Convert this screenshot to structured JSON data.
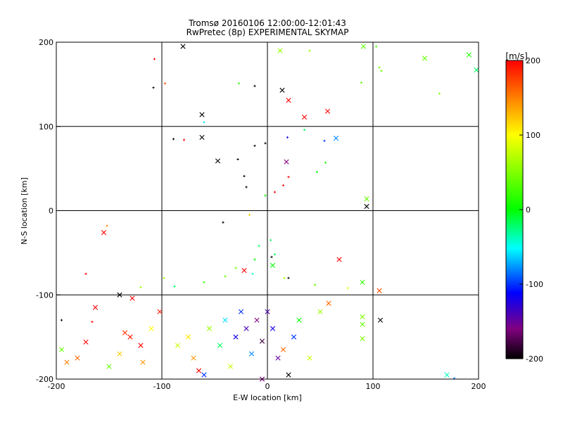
{
  "chart_data": {
    "type": "scatter",
    "title": "Tromsø 20160106 12:00:00-12:01:43",
    "subtitle": "RwPretec (8p) EXPERIMENTAL SKYMAP",
    "xlabel": "E-W location [km]",
    "ylabel": "N-S location [km]",
    "xlim": [
      -200,
      200
    ],
    "ylim": [
      -200,
      200
    ],
    "xticks": [
      "-200",
      "-100",
      "0",
      "100",
      "200"
    ],
    "yticks": [
      "-200",
      "-100",
      "0",
      "100",
      "200"
    ],
    "grid": true,
    "colorbar": {
      "label": "[m/s]",
      "range": [
        -200,
        200
      ],
      "ticks": [
        "200",
        "100",
        "0",
        "-100",
        "-200"
      ]
    },
    "points": [
      {
        "x": -80,
        "y": 195,
        "v": -200,
        "m": "x"
      },
      {
        "x": -107,
        "y": 180,
        "v": 200,
        "m": "+"
      },
      {
        "x": -108,
        "y": 146,
        "v": -200,
        "m": "+"
      },
      {
        "x": -97,
        "y": 151,
        "v": 170,
        "m": "+"
      },
      {
        "x": 12,
        "y": 190,
        "v": 60,
        "m": "x"
      },
      {
        "x": 40,
        "y": 190,
        "v": 60,
        "m": "+"
      },
      {
        "x": 91,
        "y": 195,
        "v": 40,
        "m": "x"
      },
      {
        "x": 103,
        "y": 195,
        "v": 30,
        "m": "+"
      },
      {
        "x": 106,
        "y": 170,
        "v": 50,
        "m": "+"
      },
      {
        "x": 108,
        "y": 166,
        "v": 40,
        "m": "+"
      },
      {
        "x": 149,
        "y": 181,
        "v": 40,
        "m": "x"
      },
      {
        "x": 191,
        "y": 185,
        "v": 10,
        "m": "x"
      },
      {
        "x": 198,
        "y": 167,
        "v": -20,
        "m": "x"
      },
      {
        "x": 163,
        "y": 139,
        "v": 50,
        "m": "+"
      },
      {
        "x": 89,
        "y": 152,
        "v": 40,
        "m": "+"
      },
      {
        "x": -27,
        "y": 151,
        "v": 20,
        "m": "+"
      },
      {
        "x": -12,
        "y": 148,
        "v": -200,
        "m": "+"
      },
      {
        "x": 14,
        "y": 143,
        "v": -200,
        "m": "x"
      },
      {
        "x": 20,
        "y": 131,
        "v": 200,
        "m": "x"
      },
      {
        "x": 57,
        "y": 118,
        "v": 200,
        "m": "x"
      },
      {
        "x": 35,
        "y": 111,
        "v": 200,
        "m": "x"
      },
      {
        "x": -62,
        "y": 114,
        "v": -200,
        "m": "x"
      },
      {
        "x": -60,
        "y": 105,
        "v": -60,
        "m": "+"
      },
      {
        "x": -62,
        "y": 87,
        "v": -200,
        "m": "x"
      },
      {
        "x": -89,
        "y": 85,
        "v": -200,
        "m": "+"
      },
      {
        "x": -79,
        "y": 84,
        "v": 200,
        "m": "+"
      },
      {
        "x": 19,
        "y": 87,
        "v": -120,
        "m": "+"
      },
      {
        "x": 65,
        "y": 86,
        "v": -80,
        "m": "x"
      },
      {
        "x": 54,
        "y": 83,
        "v": -100,
        "m": "+"
      },
      {
        "x": -2,
        "y": 80,
        "v": -200,
        "m": "+"
      },
      {
        "x": -12,
        "y": 77,
        "v": -200,
        "m": "+"
      },
      {
        "x": 35,
        "y": 96,
        "v": -20,
        "m": "+"
      },
      {
        "x": -47,
        "y": 59,
        "v": -200,
        "m": "x"
      },
      {
        "x": 18,
        "y": 58,
        "v": -160,
        "m": "x"
      },
      {
        "x": -28,
        "y": 61,
        "v": -200,
        "m": "+"
      },
      {
        "x": 55,
        "y": 57,
        "v": 10,
        "m": "+"
      },
      {
        "x": 47,
        "y": 46,
        "v": 0,
        "m": "+"
      },
      {
        "x": -22,
        "y": 41,
        "v": -200,
        "m": "+"
      },
      {
        "x": 20,
        "y": 40,
        "v": 200,
        "m": "+"
      },
      {
        "x": 15,
        "y": 30,
        "v": 200,
        "m": "+"
      },
      {
        "x": -20,
        "y": 28,
        "v": -200,
        "m": "+"
      },
      {
        "x": 7,
        "y": 22,
        "v": 200,
        "m": "+"
      },
      {
        "x": -2,
        "y": 18,
        "v": 0,
        "m": "+"
      },
      {
        "x": 94,
        "y": 14,
        "v": 40,
        "m": "x"
      },
      {
        "x": 94,
        "y": 5,
        "v": -200,
        "m": "x"
      },
      {
        "x": -155,
        "y": -26,
        "v": 200,
        "m": "x"
      },
      {
        "x": -152,
        "y": -18,
        "v": 150,
        "m": "+"
      },
      {
        "x": -42,
        "y": -14,
        "v": -200,
        "m": "+"
      },
      {
        "x": -17,
        "y": -5,
        "v": 120,
        "m": "+"
      },
      {
        "x": 68,
        "y": -58,
        "v": 200,
        "m": "x"
      },
      {
        "x": 5,
        "y": -65,
        "v": 0,
        "m": "x"
      },
      {
        "x": -22,
        "y": -71,
        "v": 200,
        "m": "x"
      },
      {
        "x": -172,
        "y": -75,
        "v": 200,
        "m": "+"
      },
      {
        "x": 20,
        "y": -80,
        "v": -200,
        "m": "+"
      },
      {
        "x": 90,
        "y": -85,
        "v": 20,
        "m": "x"
      },
      {
        "x": 106,
        "y": -95,
        "v": 170,
        "m": "x"
      },
      {
        "x": -140,
        "y": -100,
        "v": -200,
        "m": "x"
      },
      {
        "x": -128,
        "y": -104,
        "v": 200,
        "m": "x"
      },
      {
        "x": -163,
        "y": -115,
        "v": 200,
        "m": "x"
      },
      {
        "x": 90,
        "y": -126,
        "v": 50,
        "m": "x"
      },
      {
        "x": 90,
        "y": -135,
        "v": 40,
        "m": "x"
      },
      {
        "x": 107,
        "y": -130,
        "v": -200,
        "m": "x"
      },
      {
        "x": 90,
        "y": -152,
        "v": 50,
        "m": "x"
      },
      {
        "x": -195,
        "y": -130,
        "v": -200,
        "m": "+"
      },
      {
        "x": -166,
        "y": -132,
        "v": 200,
        "m": "+"
      },
      {
        "x": -135,
        "y": -145,
        "v": 180,
        "m": "x"
      },
      {
        "x": -172,
        "y": -156,
        "v": 200,
        "m": "x"
      },
      {
        "x": -140,
        "y": -170,
        "v": 120,
        "m": "x"
      },
      {
        "x": -190,
        "y": -180,
        "v": 150,
        "m": "x"
      },
      {
        "x": -195,
        "y": -165,
        "v": 40,
        "m": "x"
      },
      {
        "x": -180,
        "y": -175,
        "v": 160,
        "m": "x"
      },
      {
        "x": -150,
        "y": -185,
        "v": 40,
        "m": "x"
      },
      {
        "x": -130,
        "y": -150,
        "v": 190,
        "m": "x"
      },
      {
        "x": -120,
        "y": -160,
        "v": 200,
        "m": "x"
      },
      {
        "x": -110,
        "y": -140,
        "v": 100,
        "m": "x"
      },
      {
        "x": -118,
        "y": -180,
        "v": 140,
        "m": "x"
      },
      {
        "x": -102,
        "y": -120,
        "v": 190,
        "m": "x"
      },
      {
        "x": -85,
        "y": -160,
        "v": 80,
        "m": "x"
      },
      {
        "x": -75,
        "y": -150,
        "v": 110,
        "m": "x"
      },
      {
        "x": -70,
        "y": -175,
        "v": 140,
        "m": "x"
      },
      {
        "x": -65,
        "y": -190,
        "v": 200,
        "m": "x"
      },
      {
        "x": -60,
        "y": -195,
        "v": -100,
        "m": "x"
      },
      {
        "x": -55,
        "y": -140,
        "v": 60,
        "m": "x"
      },
      {
        "x": -45,
        "y": -160,
        "v": -20,
        "m": "x"
      },
      {
        "x": -40,
        "y": -130,
        "v": -60,
        "m": "x"
      },
      {
        "x": -35,
        "y": -185,
        "v": 80,
        "m": "x"
      },
      {
        "x": -30,
        "y": -150,
        "v": -120,
        "m": "x"
      },
      {
        "x": -25,
        "y": -120,
        "v": -100,
        "m": "x"
      },
      {
        "x": -20,
        "y": -140,
        "v": -140,
        "m": "x"
      },
      {
        "x": -15,
        "y": -170,
        "v": -80,
        "m": "x"
      },
      {
        "x": -10,
        "y": -130,
        "v": -160,
        "m": "x"
      },
      {
        "x": -5,
        "y": -155,
        "v": -180,
        "m": "x"
      },
      {
        "x": 0,
        "y": -120,
        "v": -140,
        "m": "x"
      },
      {
        "x": 5,
        "y": -140,
        "v": -120,
        "m": "x"
      },
      {
        "x": 10,
        "y": -175,
        "v": -150,
        "m": "x"
      },
      {
        "x": 15,
        "y": -165,
        "v": 160,
        "m": "x"
      },
      {
        "x": 20,
        "y": -195,
        "v": -200,
        "m": "x"
      },
      {
        "x": 25,
        "y": -150,
        "v": -100,
        "m": "x"
      },
      {
        "x": 30,
        "y": -130,
        "v": 0,
        "m": "x"
      },
      {
        "x": 40,
        "y": -175,
        "v": 80,
        "m": "x"
      },
      {
        "x": 50,
        "y": -120,
        "v": 60,
        "m": "x"
      },
      {
        "x": 58,
        "y": -110,
        "v": 160,
        "m": "x"
      },
      {
        "x": -5,
        "y": -200,
        "v": -160,
        "m": "x"
      },
      {
        "x": 170,
        "y": -195,
        "v": -40,
        "m": "x"
      },
      {
        "x": 177,
        "y": -199,
        "v": -80,
        "m": "+"
      },
      {
        "x": 3,
        "y": -35,
        "v": -20,
        "m": "+"
      },
      {
        "x": -8,
        "y": -42,
        "v": -20,
        "m": "+"
      },
      {
        "x": 7,
        "y": -52,
        "v": -20,
        "m": "+"
      },
      {
        "x": -12,
        "y": -58,
        "v": 0,
        "m": "+"
      },
      {
        "x": 4,
        "y": -55,
        "v": -200,
        "m": "+"
      },
      {
        "x": -30,
        "y": -68,
        "v": 40,
        "m": "+"
      },
      {
        "x": -14,
        "y": -75,
        "v": -40,
        "m": "+"
      },
      {
        "x": 16,
        "y": -80,
        "v": 70,
        "m": "+"
      },
      {
        "x": 45,
        "y": -88,
        "v": 40,
        "m": "+"
      },
      {
        "x": 76,
        "y": -92,
        "v": 80,
        "m": "+"
      },
      {
        "x": -120,
        "y": -91,
        "v": 60,
        "m": "+"
      },
      {
        "x": -98,
        "y": -80,
        "v": 60,
        "m": "+"
      },
      {
        "x": -88,
        "y": -90,
        "v": -20,
        "m": "+"
      },
      {
        "x": -60,
        "y": -85,
        "v": 20,
        "m": "+"
      },
      {
        "x": -40,
        "y": -78,
        "v": 40,
        "m": "+"
      }
    ]
  }
}
